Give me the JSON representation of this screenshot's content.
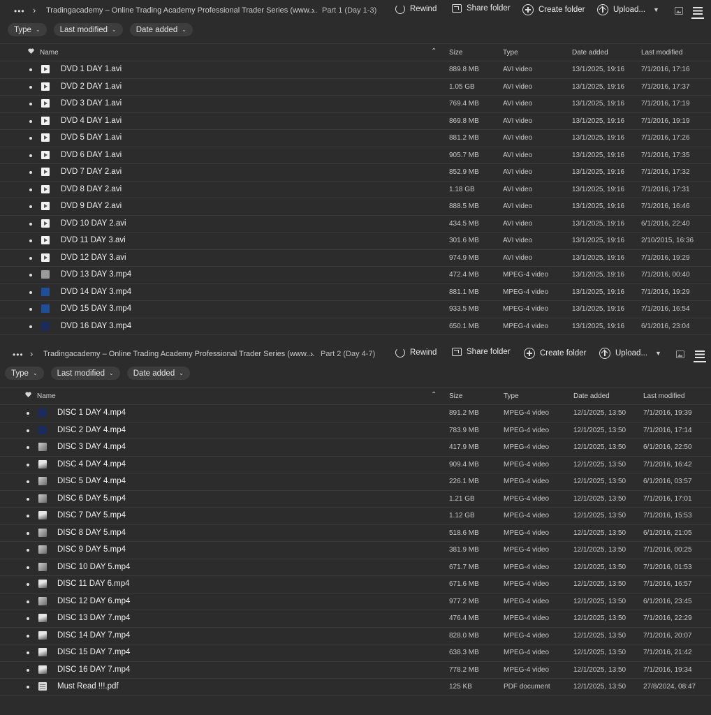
{
  "colors": {
    "background": "#2c2c2c",
    "text": "#e6e6e6",
    "pill_background": "#3d3d3d",
    "row_divider": "#3a3a3a"
  },
  "panels": [
    {
      "breadcrumb": {
        "more": "•••",
        "root": "Tradingacademy – Online Trading Academy Professional Trader Series (www....",
        "current": "Part 1 (Day 1-3)"
      },
      "actions": {
        "rewind": "Rewind",
        "share": "Share folder",
        "create": "Create folder",
        "upload": "Upload..."
      },
      "filters": [
        "Type",
        "Last modified",
        "Date added"
      ],
      "columns": {
        "name": "Name",
        "size": "Size",
        "type": "Type",
        "date_added": "Date added",
        "last_modified": "Last modified"
      },
      "rows": [
        {
          "name": "DVD 1 DAY 1.avi",
          "size": "889.8 MB",
          "type": "AVI video",
          "added": "13/1/2025, 19:16",
          "modified": "7/1/2016, 17:16",
          "thumb": "avi"
        },
        {
          "name": "DVD 2 DAY 1.avi",
          "size": "1.05 GB",
          "type": "AVI video",
          "added": "13/1/2025, 19:16",
          "modified": "7/1/2016, 17:37",
          "thumb": "avi"
        },
        {
          "name": "DVD 3 DAY 1.avi",
          "size": "769.4 MB",
          "type": "AVI video",
          "added": "13/1/2025, 19:16",
          "modified": "7/1/2016, 17:19",
          "thumb": "avi"
        },
        {
          "name": "DVD 4 DAY 1.avi",
          "size": "869.8 MB",
          "type": "AVI video",
          "added": "13/1/2025, 19:16",
          "modified": "7/1/2016, 19:19",
          "thumb": "avi"
        },
        {
          "name": "DVD 5 DAY 1.avi",
          "size": "881.2 MB",
          "type": "AVI video",
          "added": "13/1/2025, 19:16",
          "modified": "7/1/2016, 17:26",
          "thumb": "avi"
        },
        {
          "name": "DVD 6 DAY 1.avi",
          "size": "905.7 MB",
          "type": "AVI video",
          "added": "13/1/2025, 19:16",
          "modified": "7/1/2016, 17:35",
          "thumb": "avi"
        },
        {
          "name": "DVD 7 DAY 2.avi",
          "size": "852.9 MB",
          "type": "AVI video",
          "added": "13/1/2025, 19:16",
          "modified": "7/1/2016, 17:32",
          "thumb": "avi"
        },
        {
          "name": "DVD 8 DAY 2.avi",
          "size": "1.18 GB",
          "type": "AVI video",
          "added": "13/1/2025, 19:16",
          "modified": "7/1/2016, 17:31",
          "thumb": "avi"
        },
        {
          "name": "DVD 9 DAY 2.avi",
          "size": "888.5 MB",
          "type": "AVI video",
          "added": "13/1/2025, 19:16",
          "modified": "7/1/2016, 16:46",
          "thumb": "avi"
        },
        {
          "name": "DVD 10 DAY 2.avi",
          "size": "434.5 MB",
          "type": "AVI video",
          "added": "13/1/2025, 19:16",
          "modified": "6/1/2016, 22:40",
          "thumb": "avi"
        },
        {
          "name": "DVD 11 DAY 3.avi",
          "size": "301.6 MB",
          "type": "AVI video",
          "added": "13/1/2025, 19:16",
          "modified": "2/10/2015, 16:36",
          "thumb": "avi"
        },
        {
          "name": "DVD 12 DAY 3.avi",
          "size": "974.9 MB",
          "type": "AVI video",
          "added": "13/1/2025, 19:16",
          "modified": "7/1/2016, 19:29",
          "thumb": "avi"
        },
        {
          "name": "DVD 13 DAY 3.mp4",
          "size": "472.4 MB",
          "type": "MPEG-4 video",
          "added": "13/1/2025, 19:16",
          "modified": "7/1/2016, 00:40",
          "thumb": "grey"
        },
        {
          "name": "DVD 14 DAY 3.mp4",
          "size": "881.1 MB",
          "type": "MPEG-4 video",
          "added": "13/1/2025, 19:16",
          "modified": "7/1/2016, 19:29",
          "thumb": "blue"
        },
        {
          "name": "DVD 15 DAY 3.mp4",
          "size": "933.5 MB",
          "type": "MPEG-4 video",
          "added": "13/1/2025, 19:16",
          "modified": "7/1/2016, 16:54",
          "thumb": "blue"
        },
        {
          "name": "DVD 16 DAY 3.mp4",
          "size": "650.1 MB",
          "type": "MPEG-4 video",
          "added": "13/1/2025, 19:16",
          "modified": "6/1/2016, 23:04",
          "thumb": "navy"
        }
      ]
    },
    {
      "breadcrumb": {
        "more": "•••",
        "root": "Tradingacademy – Online Trading Academy Professional Trader Series (www....",
        "current": "Part 2 (Day 4-7)"
      },
      "actions": {
        "rewind": "Rewind",
        "share": "Share folder",
        "create": "Create folder",
        "upload": "Upload..."
      },
      "filters": [
        "Type",
        "Last modified",
        "Date added"
      ],
      "columns": {
        "name": "Name",
        "size": "Size",
        "type": "Type",
        "date_added": "Date added",
        "last_modified": "Last modified"
      },
      "rows": [
        {
          "name": "DISC 1 DAY 4.mp4",
          "size": "891.2 MB",
          "type": "MPEG-4 video",
          "added": "12/1/2025, 13:50",
          "modified": "7/1/2016, 19:39",
          "thumb": "navy"
        },
        {
          "name": "DISC 2 DAY 4.mp4",
          "size": "783.9 MB",
          "type": "MPEG-4 video",
          "added": "12/1/2025, 13:50",
          "modified": "7/1/2016, 17:14",
          "thumb": "navy"
        },
        {
          "name": "DISC 3 DAY 4.mp4",
          "size": "417.9 MB",
          "type": "MPEG-4 video",
          "added": "12/1/2025, 13:50",
          "modified": "6/1/2016, 22:50",
          "thumb": "photo"
        },
        {
          "name": "DISC 4 DAY 4.mp4",
          "size": "909.4 MB",
          "type": "MPEG-4 video",
          "added": "12/1/2025, 13:50",
          "modified": "7/1/2016, 16:42",
          "thumb": "photo2"
        },
        {
          "name": "DISC 5 DAY 4.mp4",
          "size": "226.1 MB",
          "type": "MPEG-4 video",
          "added": "12/1/2025, 13:50",
          "modified": "6/1/2016, 03:57",
          "thumb": "photo"
        },
        {
          "name": "DISC 6 DAY 5.mp4",
          "size": "1.21 GB",
          "type": "MPEG-4 video",
          "added": "12/1/2025, 13:50",
          "modified": "7/1/2016, 17:01",
          "thumb": "photo"
        },
        {
          "name": "DISC 7 DAY 5.mp4",
          "size": "1.12 GB",
          "type": "MPEG-4 video",
          "added": "12/1/2025, 13:50",
          "modified": "7/1/2016, 15:53",
          "thumb": "photo2"
        },
        {
          "name": "DISC 8 DAY 5.mp4",
          "size": "518.6 MB",
          "type": "MPEG-4 video",
          "added": "12/1/2025, 13:50",
          "modified": "6/1/2016, 21:05",
          "thumb": "photo"
        },
        {
          "name": "DISC 9 DAY 5.mp4",
          "size": "381.9 MB",
          "type": "MPEG-4 video",
          "added": "12/1/2025, 13:50",
          "modified": "7/1/2016, 00:25",
          "thumb": "photo"
        },
        {
          "name": "DISC 10 DAY 5.mp4",
          "size": "671.7 MB",
          "type": "MPEG-4 video",
          "added": "12/1/2025, 13:50",
          "modified": "7/1/2016, 01:53",
          "thumb": "photo"
        },
        {
          "name": "DISC 11 DAY 6.mp4",
          "size": "671.6 MB",
          "type": "MPEG-4 video",
          "added": "12/1/2025, 13:50",
          "modified": "7/1/2016, 16:57",
          "thumb": "photo2"
        },
        {
          "name": "DISC 12 DAY 6.mp4",
          "size": "977.2 MB",
          "type": "MPEG-4 video",
          "added": "12/1/2025, 13:50",
          "modified": "6/1/2016, 23:45",
          "thumb": "photo"
        },
        {
          "name": "DISC 13 DAY 7.mp4",
          "size": "476.4 MB",
          "type": "MPEG-4 video",
          "added": "12/1/2025, 13:50",
          "modified": "7/1/2016, 22:29",
          "thumb": "photo2"
        },
        {
          "name": "DISC 14 DAY 7.mp4",
          "size": "828.0 MB",
          "type": "MPEG-4 video",
          "added": "12/1/2025, 13:50",
          "modified": "7/1/2016, 20:07",
          "thumb": "photo2"
        },
        {
          "name": "DISC 15 DAY 7.mp4",
          "size": "638.3 MB",
          "type": "MPEG-4 video",
          "added": "12/1/2025, 13:50",
          "modified": "7/1/2016, 21:42",
          "thumb": "photo2"
        },
        {
          "name": "DISC 16 DAY 7.mp4",
          "size": "778.2 MB",
          "type": "MPEG-4 video",
          "added": "12/1/2025, 13:50",
          "modified": "7/1/2016, 19:34",
          "thumb": "photo2"
        },
        {
          "name": "Must Read !!!.pdf",
          "size": "125 KB",
          "type": "PDF document",
          "added": "12/1/2025, 13:50",
          "modified": "27/8/2024, 08:47",
          "thumb": "doc"
        }
      ]
    }
  ]
}
